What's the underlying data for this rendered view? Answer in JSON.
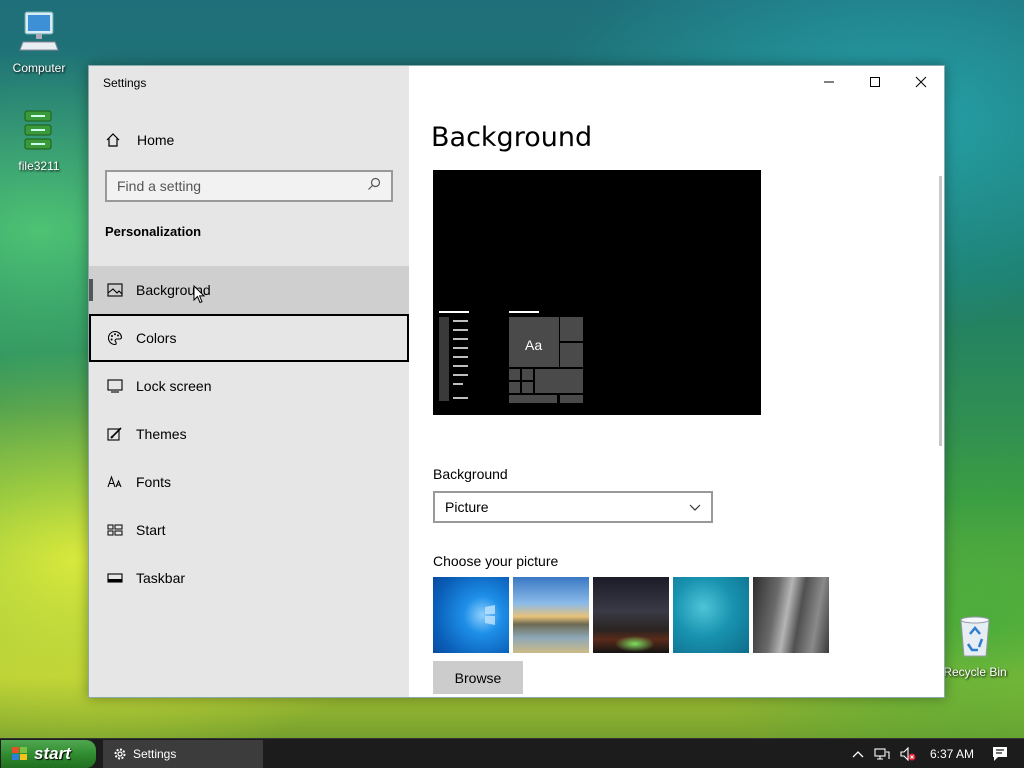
{
  "desktop": {
    "icons": [
      {
        "label": "Computer",
        "icon": "computer-icon"
      },
      {
        "label": "file3211",
        "icon": "file-icon"
      },
      {
        "label": "Recycle Bin",
        "icon": "recycle-bin-icon"
      }
    ]
  },
  "window": {
    "title": "Settings",
    "sidebar": {
      "home_label": "Home",
      "search_placeholder": "Find a setting",
      "section_title": "Personalization",
      "items": [
        {
          "label": "Background",
          "icon": "picture-icon",
          "state": "selected"
        },
        {
          "label": "Colors",
          "icon": "palette-icon",
          "state": "focused"
        },
        {
          "label": "Lock screen",
          "icon": "lock-screen-icon"
        },
        {
          "label": "Themes",
          "icon": "brush-icon"
        },
        {
          "label": "Fonts",
          "icon": "font-icon"
        },
        {
          "label": "Start",
          "icon": "start-layout-icon"
        },
        {
          "label": "Taskbar",
          "icon": "taskbar-icon"
        }
      ]
    },
    "main": {
      "page_title": "Background",
      "preview_tile_text": "Aa",
      "background_label": "Background",
      "background_value": "Picture",
      "choose_picture_label": "Choose your picture",
      "browse_label": "Browse"
    }
  },
  "taskbar": {
    "start_label": "start",
    "task_label": "Settings",
    "clock": "6:37 AM"
  },
  "colors": {
    "sidebar_bg": "#e6e6e6",
    "selected_bg": "#cfcfcf",
    "taskbar_bg": "#1c1c1c",
    "start_green": "#2f8a2f"
  }
}
